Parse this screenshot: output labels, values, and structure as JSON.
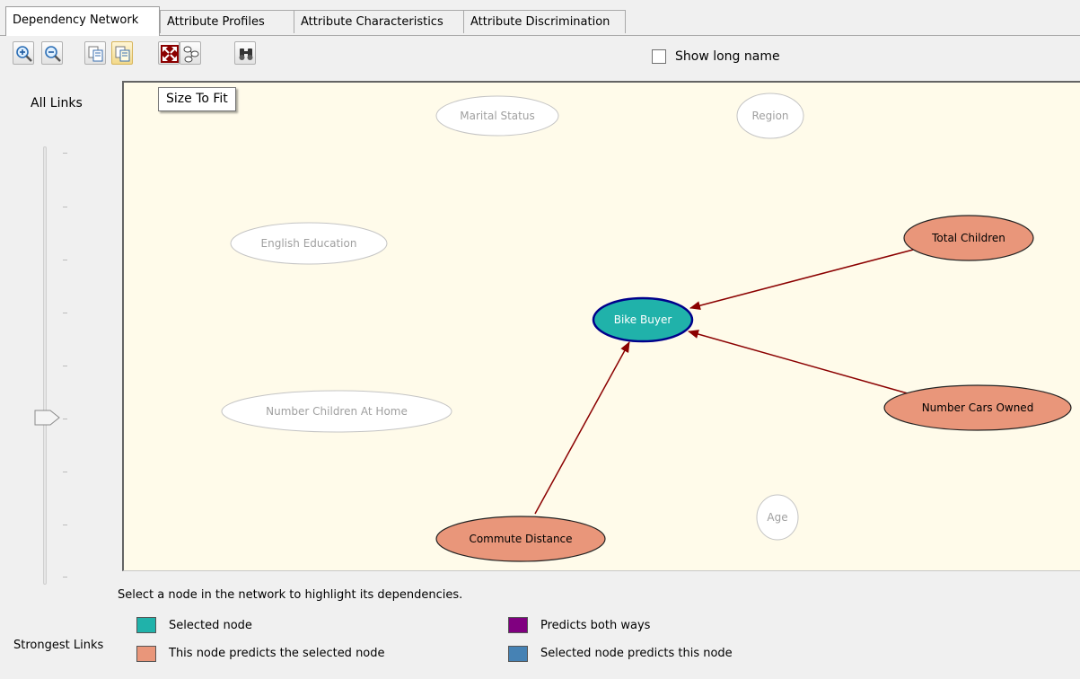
{
  "tabs": [
    {
      "label": "Dependency Network",
      "active": true
    },
    {
      "label": "Attribute Profiles",
      "active": false
    },
    {
      "label": "Attribute Characteristics",
      "active": false
    },
    {
      "label": "Attribute Discrimination",
      "active": false
    }
  ],
  "toolbar": {
    "buttons": [
      {
        "icon": "zoom-in-icon"
      },
      {
        "icon": "zoom-out-icon"
      },
      {
        "icon": "copy-icon"
      },
      {
        "icon": "copy-graph-view-icon"
      },
      {
        "icon": "size-to-fit-icon"
      },
      {
        "icon": "network-layout-icon"
      },
      {
        "icon": "find-node-icon"
      }
    ],
    "show_long_name_label": "Show long name",
    "show_long_name_checked": false
  },
  "tooltip": "Size To Fit",
  "slider": {
    "label": "All Links",
    "bottom_label": "Strongest Links"
  },
  "network": {
    "nodes": [
      {
        "id": "marital-status",
        "label": "Marital Status",
        "role": "unrelated"
      },
      {
        "id": "region",
        "label": "Region",
        "role": "unrelated"
      },
      {
        "id": "english-education",
        "label": "English Education",
        "role": "unrelated"
      },
      {
        "id": "total-children",
        "label": "Total Children",
        "role": "predicts-selected"
      },
      {
        "id": "bike-buyer",
        "label": "Bike Buyer",
        "role": "selected"
      },
      {
        "id": "number-children-at-home",
        "label": "Number Children At Home",
        "role": "unrelated"
      },
      {
        "id": "number-cars-owned",
        "label": "Number Cars Owned",
        "role": "predicts-selected"
      },
      {
        "id": "age",
        "label": "Age",
        "role": "unrelated"
      },
      {
        "id": "commute-distance",
        "label": "Commute Distance",
        "role": "predicts-selected"
      }
    ],
    "links": [
      {
        "from": "total-children",
        "to": "bike-buyer"
      },
      {
        "from": "number-cars-owned",
        "to": "bike-buyer"
      },
      {
        "from": "commute-distance",
        "to": "bike-buyer"
      }
    ]
  },
  "hint": "Select a node in the network to highlight its dependencies.",
  "legend": [
    {
      "label": "Selected node",
      "color": "#20b2aa"
    },
    {
      "label": "This node predicts the selected node",
      "color": "#e9967a"
    },
    {
      "label": "Predicts both ways",
      "color": "#800080"
    },
    {
      "label": "Selected node predicts this node",
      "color": "#4682b4"
    }
  ],
  "colors": {
    "canvas_bg": "#fffbea",
    "link": "#8b0000",
    "selected_border": "#00008b",
    "unrelated_text": "#a0a0a0"
  }
}
